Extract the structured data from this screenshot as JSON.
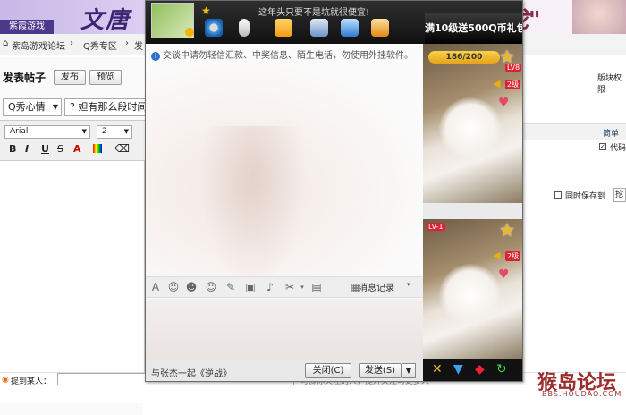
{
  "banner": {
    "logo_text": "紫霞游戏",
    "title_left": "文唐",
    "title_right": "龙\""
  },
  "nav": {
    "home": "紫岛游戏论坛",
    "section": "Q秀专区",
    "current": "发"
  },
  "editor": {
    "post_title": "发表帖子",
    "publish_btn": "发布",
    "preview_btn": "预览",
    "category_value": "Q秀心情",
    "subject_value": "? 妲有那么段时间",
    "font_value": "Arial",
    "size_value": "2",
    "toolbar_bold": "B",
    "toolbar_italic": "I",
    "toolbar_underline": "U",
    "toolbar_strike": "S",
    "toolbar_color": "A"
  },
  "right_panel": {
    "block_permission": "版块权限",
    "simple": "简单",
    "code": "代码",
    "save_also": "同时保存到",
    "dig": "挖"
  },
  "bottom_bar": {
    "mention_label": "提到某人：",
    "mention_hint": "可@你关注的人，提升关注可更多人"
  },
  "watermark": {
    "title": "猴岛论坛",
    "sub": "BBS.HOUDAO.COM"
  },
  "chat": {
    "status_text": "这年头只要不是坑就很便宜!",
    "promo": "满10级送500Q币礼包",
    "notice": "交谈中请勿轻信汇款、中奖信息、陌生电话，勿使用外挂软件。",
    "history": "消息记录",
    "footer_text": "与张杰一起《逆战》",
    "close_btn": "关闭(C)",
    "send_btn": "发送(S)",
    "score": "186/200",
    "level_1": "LV8",
    "level_2": "LV-1",
    "badge_1": "2级",
    "badge_2": "2级"
  }
}
